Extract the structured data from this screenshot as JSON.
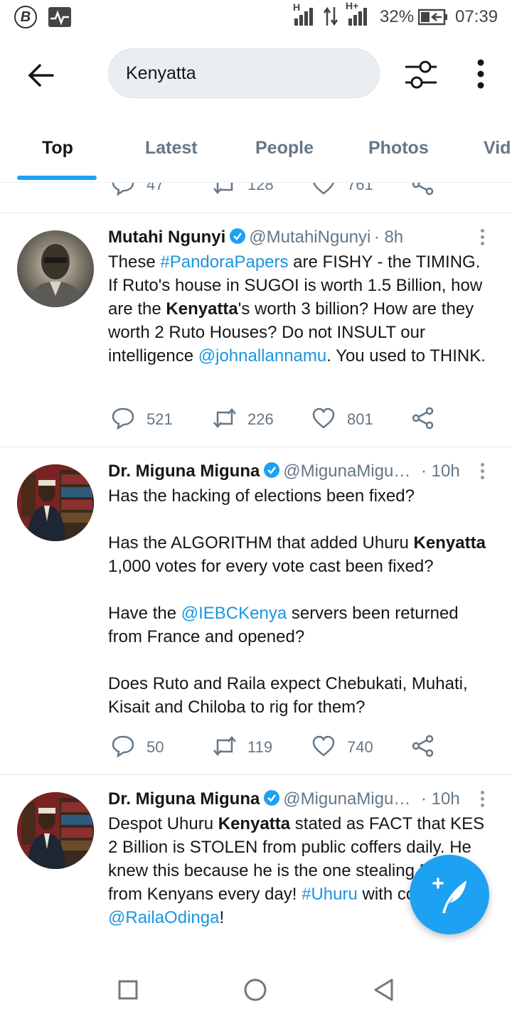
{
  "status_bar": {
    "carrier_mark": "B",
    "network_1": "H",
    "network_2": "H+",
    "battery": "32%",
    "time": "07:39"
  },
  "search": {
    "query": "Kenyatta"
  },
  "tabs": [
    {
      "label": "Top"
    },
    {
      "label": "Latest"
    },
    {
      "label": "People"
    },
    {
      "label": "Photos"
    },
    {
      "label": "Vid"
    }
  ],
  "prev_tweet_actions": {
    "replies": "47",
    "retweets": "128",
    "likes": "761"
  },
  "tweets": [
    {
      "name": "Mutahi Ngunyi",
      "handle": "@MutahiNgunyi",
      "time": "· 8h",
      "body": {
        "s1": "These ",
        "hashtag": "#PandoraPapers",
        "s2": " are FISHY - the TIMING. If Ruto's house in SUGOI is worth 1.5 Billion, how are the ",
        "kw": "Kenyatta",
        "s3": "'s worth 3 billion? How are they worth 2 Ruto Houses? Do not INSULT our intelligence ",
        "mention": "@johnallannamu",
        "s4": ". You used to THINK."
      },
      "replies": "521",
      "retweets": "226",
      "likes": "801"
    },
    {
      "name": "Dr. Miguna Miguna",
      "handle": "@MigunaMigu…",
      "time": "· 10h",
      "body": {
        "p1": "Has the hacking of elections been fixed?",
        "p2a": "Has the ALGORITHM that added Uhuru ",
        "p2kw": "Kenyatta",
        "p2b": " 1,000 votes for every vote cast been fixed?",
        "p3a": "Have the ",
        "p3m": "@IEBCKenya",
        "p3b": " servers been returned from France and opened?",
        "p4": "Does Ruto and Raila expect Chebukati, Muhati, Kisait and Chiloba to rig for them?"
      },
      "replies": "50",
      "retweets": "119",
      "likes": "740"
    },
    {
      "name": "Dr. Miguna Miguna",
      "handle": "@MigunaMigu…",
      "time": "· 10h",
      "body": {
        "s1": "Despot Uhuru ",
        "kw": "Kenyatta",
        "s2": " stated as FACT that KES 2 Billion is STOLEN from public coffers daily. He knew this because he is the one stealing",
        "s3": " Billion from Kenyans every day! ",
        "hashtag": "#Uhuru",
        "s4": " with conman ",
        "mention": "@RailaOdinga",
        "s5": "!"
      }
    }
  ],
  "icons": {
    "back": "arrow-left-icon",
    "filter": "sliders-icon",
    "more": "more-vertical-icon",
    "reply": "reply-icon",
    "retweet": "retweet-icon",
    "like": "heart-icon",
    "share": "share-icon",
    "compose": "compose-tweet-icon"
  },
  "colors": {
    "accent": "#1da1f2",
    "link": "#1b95e0",
    "muted": "#657786",
    "verified": "#1da1f2"
  }
}
